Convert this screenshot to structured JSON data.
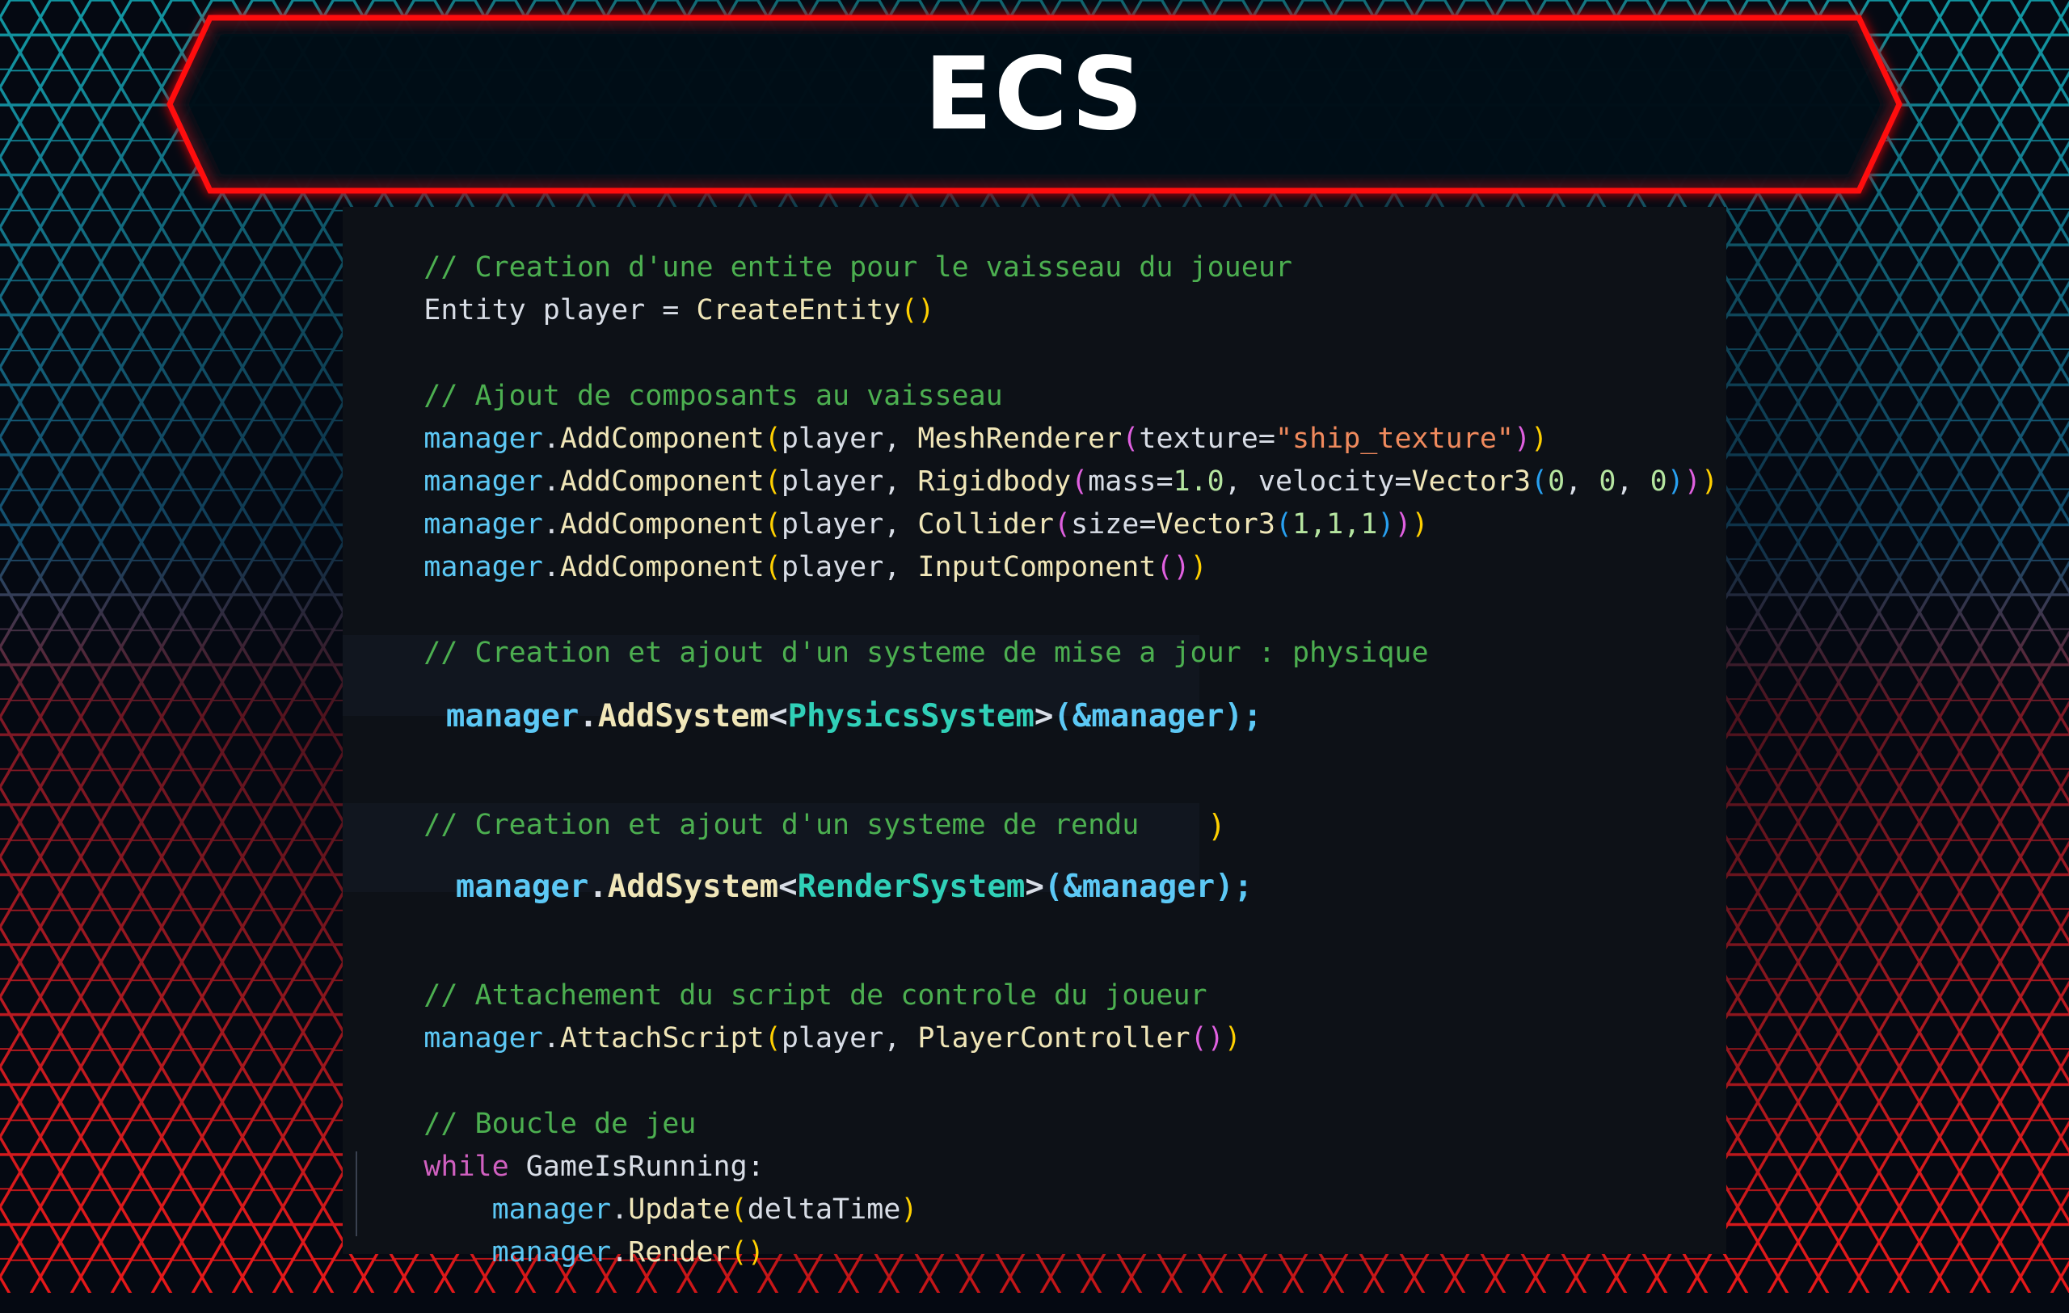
{
  "slide": {
    "title": "ECS"
  },
  "colors": {
    "background": "#050912",
    "banner_border": "#ff1010",
    "hex_top": "#13a5b0",
    "hex_bottom": "#ff1a1a",
    "panel": "#0d1117"
  },
  "code": {
    "l1": {
      "comment": "// Creation d'une entite pour le vaisseau du joueur"
    },
    "l2": {
      "a": "Entity player = ",
      "fn": "CreateEntity",
      "p": "()"
    },
    "l4": {
      "comment": "// Ajout de composants au vaisseau"
    },
    "l5": {
      "obj": "manager",
      "dot": ".",
      "fn": "AddComponent",
      "p1": "(",
      "a": "player, ",
      "fn2": "MeshRenderer",
      "p2": "(",
      "b": "texture=",
      "str": "\"ship_texture\"",
      "p2c": ")",
      "p1c": ")"
    },
    "l6": {
      "obj": "manager",
      "dot": ".",
      "fn": "AddComponent",
      "p1": "(",
      "a": "player, ",
      "fn2": "Rigidbody",
      "p2": "(",
      "b": "mass=",
      "n1": "1.0",
      "c": ", velocity=",
      "fn3": "Vector3",
      "p3": "(",
      "n2": "0",
      "d": ", ",
      "n3": "0",
      "e": ", ",
      "n4": "0",
      "p3c": ")",
      "p2c": ")",
      "p1c": ")"
    },
    "l7": {
      "obj": "manager",
      "dot": ".",
      "fn": "AddComponent",
      "p1": "(",
      "a": "player, ",
      "fn2": "Collider",
      "p2": "(",
      "b": "size=",
      "fn3": "Vector3",
      "p3": "(",
      "n": "1,1,1",
      "p3c": ")",
      "p2c": ")",
      "p1c": ")"
    },
    "l8": {
      "obj": "manager",
      "dot": ".",
      "fn": "AddComponent",
      "p1": "(",
      "a": "player, ",
      "fn2": "InputComponent",
      "p2": "()",
      "p1c": ")"
    },
    "l10": {
      "comment": "// Creation et ajout d'un systeme de mise a jour : physique"
    },
    "snippet1": {
      "obj": "manager",
      "dot": ".",
      "fn": "AddSystem",
      "lt": "<",
      "type": "PhysicsSystem",
      "gt": ">",
      "rest": "(&manager);"
    },
    "l14": {
      "comment": "// Creation et ajout d'un systeme de rendu"
    },
    "snippet2": {
      "obj": "manager",
      "dot": ".",
      "fn": "AddSystem",
      "lt": "<",
      "type": "RenderSystem",
      "gt": ">",
      "rest": "(&manager);"
    },
    "stray": ")",
    "l18": {
      "comment": "// Attachement du script de controle du joueur"
    },
    "l19": {
      "obj": "manager",
      "dot": ".",
      "fn": "AttachScript",
      "p1": "(",
      "a": "player, ",
      "fn2": "PlayerController",
      "p2": "()",
      "p1c": ")"
    },
    "l21": {
      "comment": "// Boucle de jeu"
    },
    "l22": {
      "kw": "while",
      "a": " GameIsRunning:"
    },
    "l23": {
      "indent": "    ",
      "obj": "manager",
      "dot": ".",
      "fn": "Update",
      "p1": "(",
      "a": "deltaTime",
      "p1c": ")"
    },
    "l24": {
      "indent": "    ",
      "obj": "manager",
      "dot": ".",
      "fn": "Render",
      "p1": "()"
    }
  }
}
